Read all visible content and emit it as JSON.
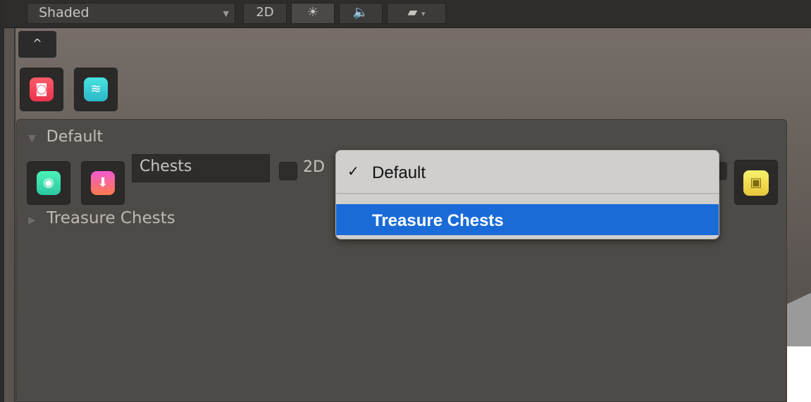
{
  "toolbar": {
    "shading_mode": "Shaded",
    "btn_2d": "2D",
    "light_icon": "sun-icon",
    "audio_icon": "speaker-icon",
    "effects_icon": "image-landscape-icon"
  },
  "collapse_label": "^",
  "tools": {
    "screenshot_icon": "camera-icon",
    "layers_icon": "layers-icon"
  },
  "panel": {
    "header": "Default",
    "name_value": "Chests",
    "label_2d": "2D",
    "treasure_row": "Treasure Chests",
    "visibility_icon": "eye-icon",
    "pin_icon": "pin-icon",
    "trash_icon": "trash-icon"
  },
  "menu": {
    "items": [
      {
        "label": "Default",
        "checked": true
      },
      {
        "label": "Treasure Chests",
        "highlighted": true
      }
    ],
    "checkmark": "✓",
    "highlight_color": "#1a6bd8"
  }
}
